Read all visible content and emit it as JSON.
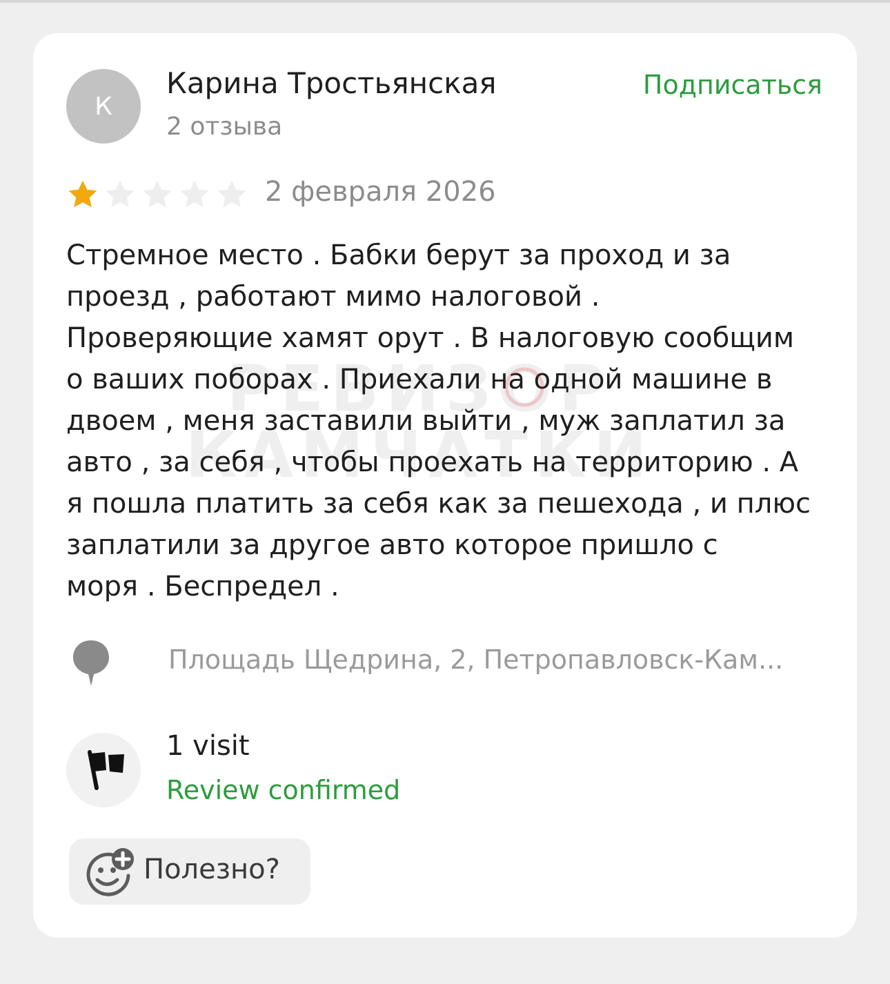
{
  "review": {
    "author": {
      "initial": "К",
      "name": "Карина Тростьянская",
      "reviews_count": "2 отзыва",
      "avatar_color": "#c2c2c2"
    },
    "subscribe_label": "Подписаться",
    "rating": {
      "value": 1,
      "max": 5,
      "filled_color": "#f2a90e",
      "empty_color": "#eeeeee"
    },
    "date": "2 февраля 2026",
    "text": "Стремное место . Бабки берут за проход и за\nпроезд , работают мимо налоговой .\nПроверяющие хамят орут . В налоговую сообщим\nо ваших поборах . Приехали на одной машине в\nдвоем , меня заставили выйти , муж заплатил за\nавто , за себя , чтобы проехать на территорию . А\nя пошла платить за себя как за пешехода , и плюс\nзаплатили за другое авто которое пришло с\nморя . Беспредел .",
    "location": {
      "icon": "map-pin-icon",
      "address": "Площадь Щедрина, 2, Петропавловск-Кам..."
    },
    "visit": {
      "icon": "flag-icon",
      "count_label": "1 visit",
      "status_label": "Review confirmed"
    },
    "useful": {
      "icon": "smile-plus-icon",
      "label": "Полезно?"
    }
  },
  "watermark": {
    "line1": "РЕВИЗОР",
    "line2": "КАМЧАТКИ"
  },
  "colors": {
    "accent_green": "#2b9c3d",
    "text_primary": "#1f1f1f",
    "text_secondary": "#8c8c8c",
    "page_background": "#efefef",
    "card_background": "#ffffff"
  }
}
